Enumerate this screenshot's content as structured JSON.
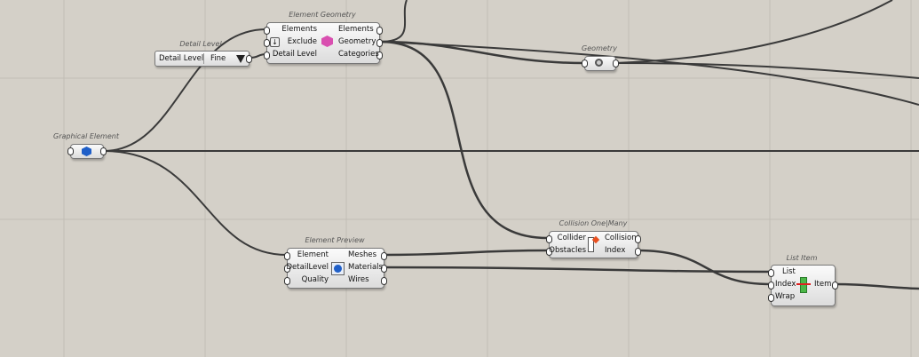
{
  "nodes": {
    "element_geometry": {
      "title": "Element Geometry",
      "inputs": [
        "Elements",
        "Exclude",
        "Detail Level"
      ],
      "outputs": [
        "Elements",
        "Geometry",
        "Categories"
      ]
    },
    "detail_level": {
      "title": "Detail Level",
      "label": "Detail Level",
      "value": "Fine"
    },
    "geometry": {
      "title": "Geometry"
    },
    "graphical_element": {
      "title": "Graphical Element"
    },
    "element_preview": {
      "title": "Element Preview",
      "inputs": [
        "Element",
        "DetailLevel",
        "Quality"
      ],
      "outputs": [
        "Meshes",
        "Materials",
        "Wires"
      ]
    },
    "collision": {
      "title": "Collision One|Many",
      "inputs": [
        "Collider",
        "Obstacles"
      ],
      "outputs": [
        "Collision",
        "Index"
      ]
    },
    "list_item": {
      "title": "List Item",
      "inputs": [
        "List",
        "Index",
        "Wrap"
      ],
      "outputs": [
        "Item"
      ]
    }
  },
  "colors": {
    "canvas": "#d4d0c8",
    "wire": "#3a3a3a",
    "grid": "#c4c0b8"
  }
}
